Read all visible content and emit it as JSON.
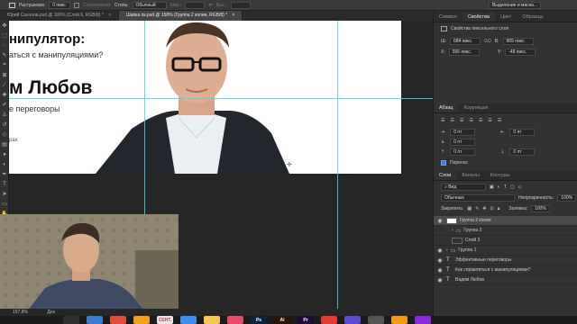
{
  "options_bar": {
    "feather_label": "Растушевка:",
    "feather_value": "0 пикс.",
    "antialias_label": "Сглаживание",
    "style_label": "Стиль:",
    "style_value": "Обычный",
    "width_label": "Шир.:",
    "height_label": "Выс.:",
    "select_mask_button": "Выделение и маска..."
  },
  "doc_tabs": [
    {
      "label": "Юрий Соколов.psd @ 100% (Слой 6, RGB/8) *"
    },
    {
      "label": "Шапка пк.psd @ 158% (Группа 2 копия, RGB/8) *"
    }
  ],
  "document": {
    "line1": "нипулятор:",
    "line2": "аться с манипуляциями?",
    "line3": "м Любов",
    "line4": "е переговоры",
    "line5": "рах"
  },
  "status": {
    "zoom": "157,8%",
    "doc_info": "Док"
  },
  "panel_tabs": [
    "Символ",
    "Свойства",
    "Цвет",
    "Образцы"
  ],
  "properties": {
    "title": "Свойства пиксельного слоя",
    "w_label": "Ш:",
    "w_value": "684 пикс.",
    "link": "GO",
    "h_label": "В:",
    "h_value": "969 пикс.",
    "x_label": "X:",
    "x_value": "556 пикс.",
    "y_label": "Y:",
    "y_value": "-48 пикс."
  },
  "paragraph_tabs": [
    "Абзац",
    "Коррекция"
  ],
  "paragraph": {
    "indent_left": "0 пт",
    "indent_right": "0 пт",
    "first_line": "0 пт",
    "space_before": "0 пт",
    "space_after": "0 пт",
    "hyphenate": "Перенос"
  },
  "layers_tabs": [
    "Слои",
    "Каналы",
    "Контуры"
  ],
  "layers_panel": {
    "filter_value": "Вид",
    "blend_mode": "Обычные",
    "opacity_label": "Непрозрачность:",
    "opacity_value": "100%",
    "lock_label": "Закрепить:",
    "fill_label": "Заливка:",
    "fill_value": "100%"
  },
  "layers": [
    {
      "name": "Группа 2 копия",
      "kind": "pixel",
      "indent": 0,
      "selected": true
    },
    {
      "name": "Группа 2",
      "kind": "folder",
      "indent": 1,
      "selected": false
    },
    {
      "name": "Слой 3",
      "kind": "pixel",
      "indent": 1,
      "selected": false
    },
    {
      "name": "Группа 1",
      "kind": "folder",
      "indent": 0,
      "selected": false
    },
    {
      "name": "Эффективные переговоры",
      "kind": "text",
      "indent": 0,
      "selected": false
    },
    {
      "name": "Как справляться с манипуляциями?",
      "kind": "text",
      "indent": 0,
      "selected": false
    },
    {
      "name": "Вадим Любов",
      "kind": "text",
      "indent": 0,
      "selected": false
    }
  ],
  "dock": [
    {
      "label": "",
      "color": "#2f2f2f"
    },
    {
      "label": "",
      "color": "#3a7bd5"
    },
    {
      "label": "",
      "color": "#e24c3b"
    },
    {
      "label": "",
      "color": "#f0a21c"
    },
    {
      "label": "СЕНТ.",
      "color": "#e8e8e8"
    },
    {
      "label": "",
      "color": "#3d8ef0"
    },
    {
      "label": "",
      "color": "#f5c84c"
    },
    {
      "label": "",
      "color": "#e94b6a"
    },
    {
      "label": "Ps",
      "color": "#0b2440"
    },
    {
      "label": "Ai",
      "color": "#2b1500"
    },
    {
      "label": "Pr",
      "color": "#1e0b3a"
    },
    {
      "label": "",
      "color": "#e53935"
    },
    {
      "label": "",
      "color": "#5b4bd6"
    },
    {
      "label": "",
      "color": "#555555"
    },
    {
      "label": "",
      "color": "#f39c12"
    },
    {
      "label": "",
      "color": "#8a2be2"
    }
  ],
  "colors": {
    "guide": "#3fd9e6",
    "selection": "#4b4b4b"
  }
}
